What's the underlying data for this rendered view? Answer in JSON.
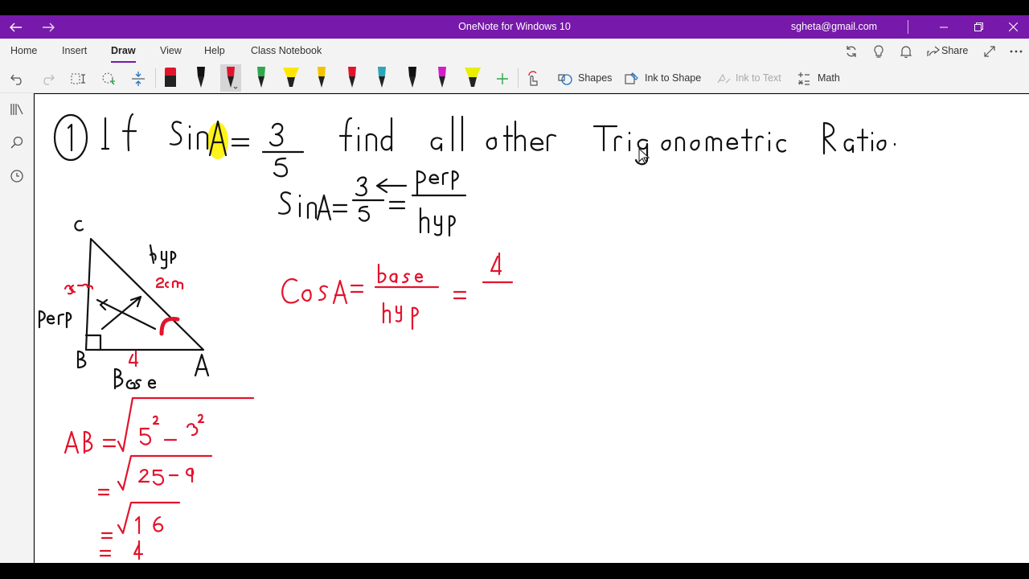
{
  "window": {
    "title": "OneNote for Windows 10",
    "account": "sgheta@gmail.com"
  },
  "tabs": [
    {
      "label": "Home"
    },
    {
      "label": "Insert"
    },
    {
      "label": "Draw",
      "active": true
    },
    {
      "label": "View"
    },
    {
      "label": "Help"
    },
    {
      "label": "Class Notebook"
    }
  ],
  "ribbon_right": {
    "share_label": "Share"
  },
  "toolbar": {
    "shapes_label": "Shapes",
    "ink_to_shape_label": "Ink to Shape",
    "ink_to_text_label": "Ink to Text",
    "math_label": "Math",
    "pens": [
      {
        "name": "eraser",
        "color": "#222222"
      },
      {
        "name": "pen-black-1",
        "color": "#111111"
      },
      {
        "name": "pen-red",
        "color": "#e2142d",
        "selected": true
      },
      {
        "name": "pen-green",
        "color": "#2fa84f"
      },
      {
        "name": "highlighter-yellow",
        "color": "#ffe600"
      },
      {
        "name": "pen-orange-yellow",
        "color": "#f4c300"
      },
      {
        "name": "pen-multicolor",
        "color": "#e2142d"
      },
      {
        "name": "pen-teal",
        "color": "#2aa6b8"
      },
      {
        "name": "pen-black-2",
        "color": "#111111"
      },
      {
        "name": "pen-magenta",
        "color": "#d01ec8"
      },
      {
        "name": "highlighter-lime",
        "color": "#e8f000"
      }
    ]
  },
  "colors": {
    "accent": "#7719aa",
    "ink_black": "#111111",
    "ink_red": "#e2142d",
    "highlight": "#fff200"
  },
  "icons": {
    "back": "arrow-left-icon",
    "forward": "arrow-right-icon",
    "sync": "sync-icon",
    "tips": "lightbulb-icon",
    "notifications": "bell-icon",
    "share": "share-icon",
    "fullscreen": "expand-icon",
    "more": "more-icon",
    "undo": "undo-icon",
    "redo": "redo-icon",
    "lasso": "lasso-select-icon",
    "add_space": "add-space-icon",
    "add_pen": "plus-icon",
    "touch_draw": "touch-draw-icon",
    "notebooks": "notebooks-icon",
    "search": "search-icon",
    "recent": "clock-icon"
  }
}
